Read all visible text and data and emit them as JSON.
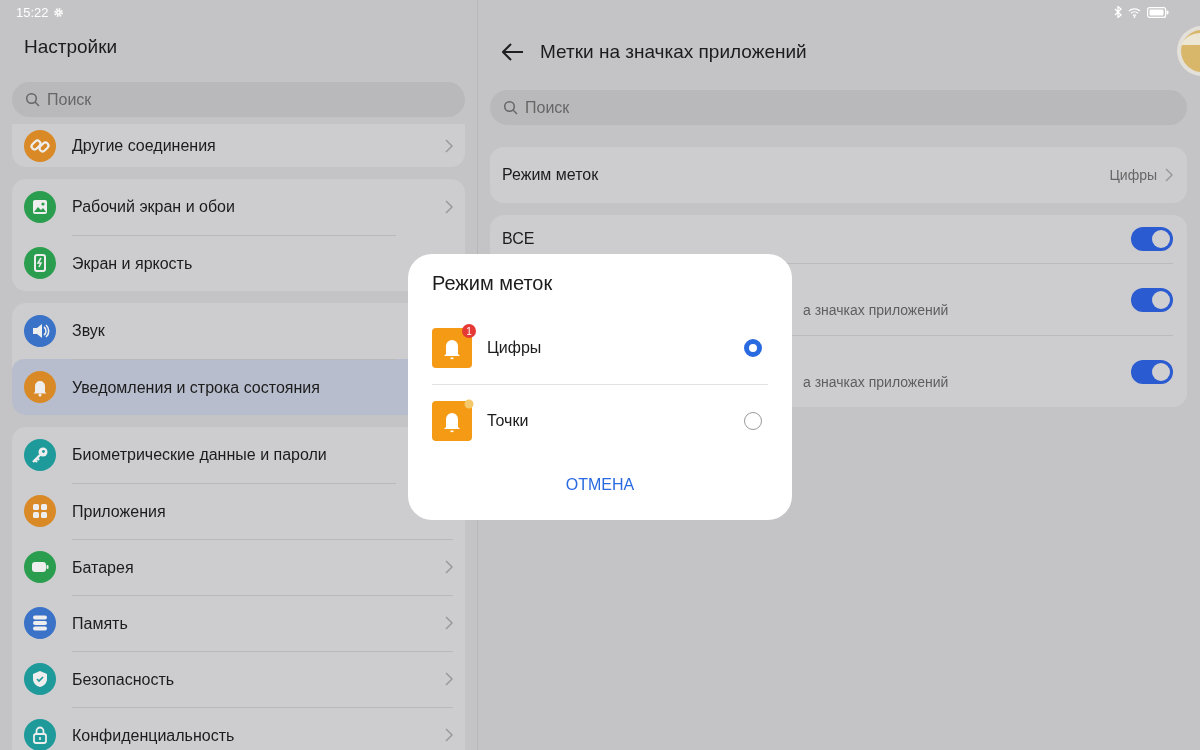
{
  "status_bar": {
    "time": "15:22"
  },
  "sidebar": {
    "title": "Настройки",
    "search": {
      "placeholder": "Поиск"
    },
    "groups": [
      {
        "items": [
          {
            "label": "Другие соединения",
            "color": "#d98a26",
            "selected": false,
            "chevron": true
          }
        ]
      },
      {
        "items": [
          {
            "label": "Рабочий экран и обои",
            "color": "#2a9e4e",
            "selected": false,
            "chevron": true
          },
          {
            "label": "Экран и яркость",
            "color": "#2a9e4e",
            "selected": false,
            "chevron": false
          }
        ]
      },
      {
        "items": [
          {
            "label": "Звук",
            "color": "#3a72c8",
            "selected": false,
            "chevron": false
          },
          {
            "label": "Уведомления и строка состояния",
            "color": "#d98a26",
            "selected": true,
            "chevron": false
          }
        ]
      },
      {
        "items": [
          {
            "label": "Биометрические данные и пароли",
            "color": "#1f9a9a",
            "selected": false,
            "chevron": false
          },
          {
            "label": "Приложения",
            "color": "#d98a26",
            "selected": false,
            "chevron": false
          },
          {
            "label": "Батарея",
            "color": "#2a9e4e",
            "selected": false,
            "chevron": true
          },
          {
            "label": "Память",
            "color": "#3a72c8",
            "selected": false,
            "chevron": true
          },
          {
            "label": "Безопасность",
            "color": "#1f9a9a",
            "selected": false,
            "chevron": true
          },
          {
            "label": "Конфиденциальность",
            "color": "#1f9a9a",
            "selected": false,
            "chevron": true
          }
        ]
      }
    ]
  },
  "detail": {
    "title": "Метки на значках приложений",
    "search": {
      "placeholder": "Поиск"
    },
    "mode_row": {
      "label": "Режим меток",
      "value": "Цифры"
    },
    "toggles": [
      {
        "label": "ВСЕ",
        "on": true
      },
      {
        "subtitle": "а значках приложений",
        "on": true
      },
      {
        "subtitle": "а значках приложений",
        "on": true
      }
    ]
  },
  "dialog": {
    "title": "Режим меток",
    "options": [
      {
        "label": "Цифры",
        "kind": "number",
        "badge": "1",
        "selected": true
      },
      {
        "label": "Точки",
        "kind": "dot",
        "selected": false
      }
    ],
    "cancel": "ОТМЕНА"
  }
}
